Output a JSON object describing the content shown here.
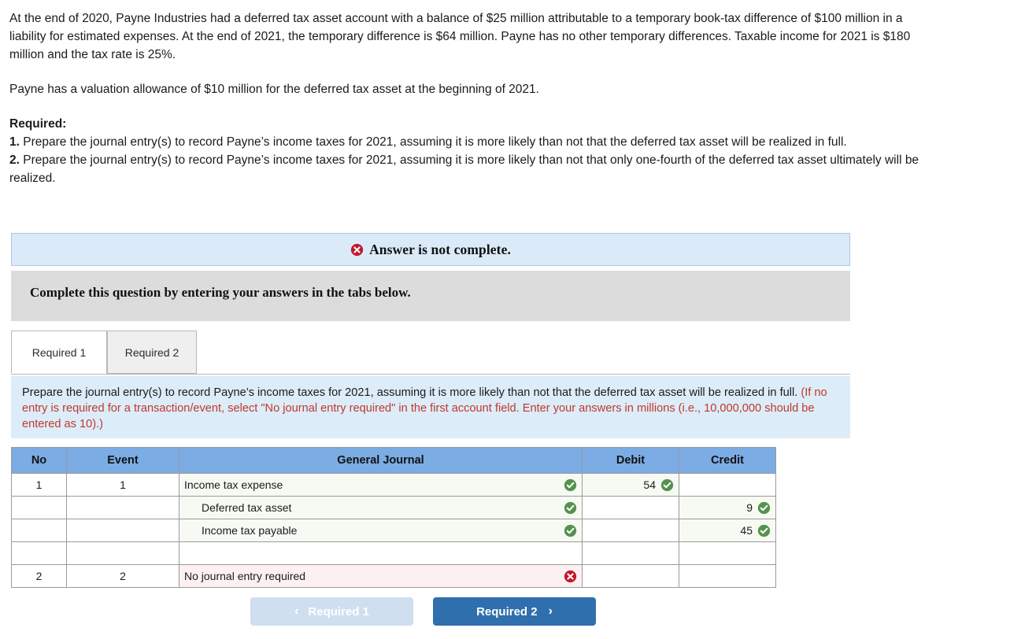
{
  "question": {
    "paragraph1": "At the end of 2020, Payne Industries had a deferred tax asset account with a balance of $25 million attributable to a temporary book-tax difference of $100 million in a liability for estimated expenses. At the end of 2021, the temporary difference is $64 million. Payne has no other temporary differences. Taxable income for 2021 is $180 million and the tax rate is 25%.",
    "paragraph2": "Payne has a valuation allowance of $10 million for the deferred tax asset at the beginning of 2021.",
    "required_label": "Required:",
    "requirement_1_num": "1.",
    "requirement_1": " Prepare the journal entry(s) to record Payne’s income taxes for 2021, assuming it is more likely than not that the deferred tax asset will be realized in full.",
    "requirement_2_num": "2.",
    "requirement_2": " Prepare the journal entry(s) to record Payne’s income taxes for 2021, assuming it is more likely than not that only one-fourth of the deferred tax asset ultimately will be realized."
  },
  "alert": {
    "icon": "error-circle-icon",
    "text": "Answer is not complete.",
    "background_color": "#dbeaf8",
    "border_color": "#a8c6e0"
  },
  "instruction_bar": {
    "text": "Complete this question by entering your answers in the tabs below.",
    "background_color": "#dcdcdc"
  },
  "tabs": [
    {
      "label": "Required 1",
      "active": true
    },
    {
      "label": "Required 2",
      "active": false
    }
  ],
  "instruction_box": {
    "main_text": "Prepare the journal entry(s) to record Payne’s income taxes for 2021, assuming it is more likely than not that the deferred tax asset will be realized in full. ",
    "note_text": "(If no entry is required for a transaction/event, select \"No journal entry required\" in the first account field. Enter your answers in millions (i.e., 10,000,000 should be entered as 10).)",
    "note_color": "#c0392b",
    "background_color": "#dcecf9"
  },
  "journal_table": {
    "header_color": "#7bace4",
    "columns": [
      "No",
      "Event",
      "General Journal",
      "Debit",
      "Credit"
    ],
    "rows": [
      {
        "no": "1",
        "event": "1",
        "account": "Income tax expense",
        "indent": false,
        "account_status": "correct",
        "debit": "54",
        "debit_status": "correct",
        "credit": "",
        "credit_status": "none"
      },
      {
        "no": "",
        "event": "",
        "account": "Deferred tax asset",
        "indent": true,
        "account_status": "correct",
        "debit": "",
        "debit_status": "none",
        "credit": "9",
        "credit_status": "correct"
      },
      {
        "no": "",
        "event": "",
        "account": "Income tax payable",
        "indent": true,
        "account_status": "correct",
        "debit": "",
        "debit_status": "none",
        "credit": "45",
        "credit_status": "correct"
      },
      {
        "no": "",
        "event": "",
        "account": "",
        "indent": false,
        "account_status": "none",
        "debit": "",
        "debit_status": "none",
        "credit": "",
        "credit_status": "none"
      },
      {
        "no": "2",
        "event": "2",
        "account": "No journal entry required",
        "indent": false,
        "account_status": "incorrect",
        "debit": "",
        "debit_status": "none",
        "credit": "",
        "credit_status": "none"
      }
    ]
  },
  "nav": {
    "prev_label": "Required 1",
    "prev_chevron": "‹",
    "prev_disabled": true,
    "prev_color": "#cfdff0",
    "next_label": "Required 2",
    "next_chevron": "›",
    "next_color": "#2f6fad"
  },
  "status_colors": {
    "correct": "#55924f",
    "incorrect": "#c2182b"
  }
}
